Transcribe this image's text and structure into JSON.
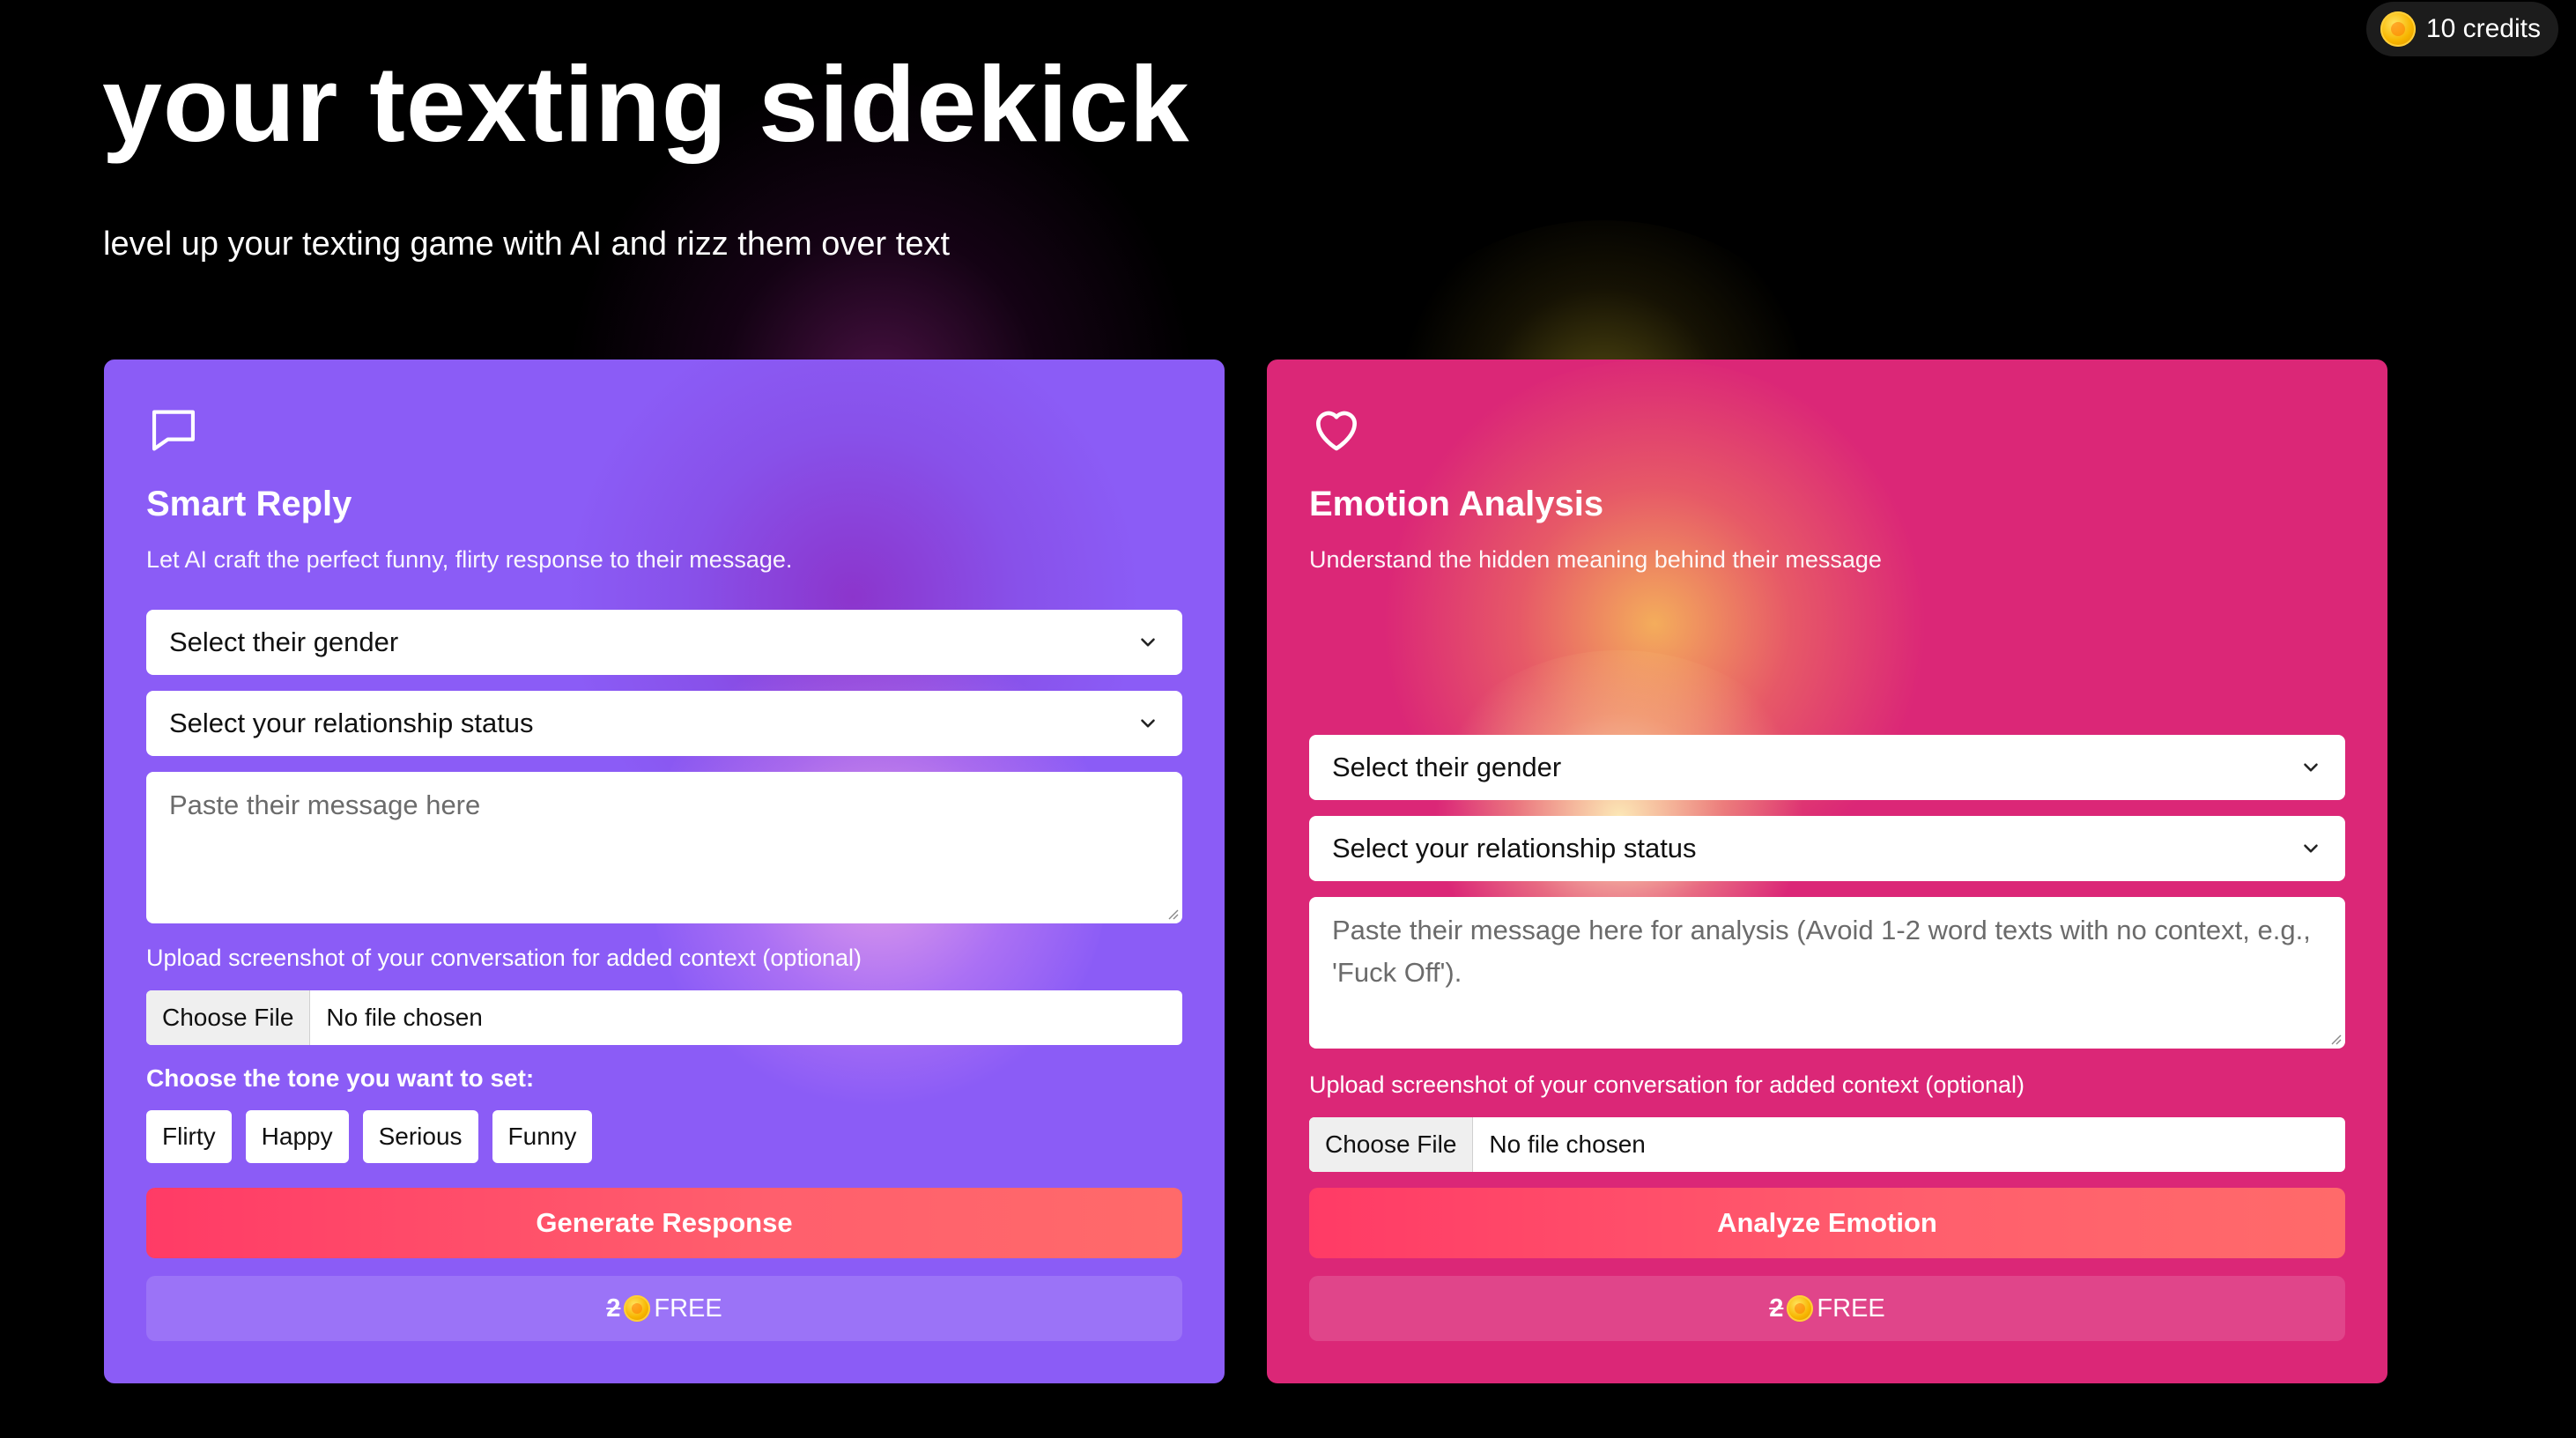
{
  "header": {
    "title": "your texting sidekick",
    "subtitle": "level up your texting game with AI and rizz them over text"
  },
  "credits": {
    "label": "10 credits",
    "icon": "coin-icon"
  },
  "smart_reply": {
    "icon": "chat-bubble-icon",
    "title": "Smart Reply",
    "description": "Let AI craft the perfect funny, flirty response to their message.",
    "gender_select": "Select their gender",
    "relationship_select": "Select your relationship status",
    "message_placeholder": "Paste their message here",
    "upload_label": "Upload screenshot of your conversation for added context (optional)",
    "file_button": "Choose File",
    "file_status": "No file chosen",
    "tone_label": "Choose the tone you want to set:",
    "tones": [
      "Flirty",
      "Happy",
      "Serious",
      "Funny"
    ],
    "action_label": "Generate Response",
    "cost_old": "2",
    "cost_new": "FREE"
  },
  "emotion_analysis": {
    "icon": "heart-icon",
    "title": "Emotion Analysis",
    "description": "Understand the hidden meaning behind their message",
    "gender_select": "Select their gender",
    "relationship_select": "Select your relationship status",
    "message_placeholder": "Paste their message here for analysis (Avoid 1-2 word texts with no context, e.g., 'Fuck Off').",
    "upload_label": "Upload screenshot of your conversation for added context (optional)",
    "file_button": "Choose File",
    "file_status": "No file chosen",
    "action_label": "Analyze Emotion",
    "cost_old": "2",
    "cost_new": "FREE"
  },
  "colors": {
    "smart_reply_card": "#8b5cf6",
    "emotion_card": "#db2777",
    "action_button": "#ff4a6a",
    "coin": "#f7b500"
  }
}
